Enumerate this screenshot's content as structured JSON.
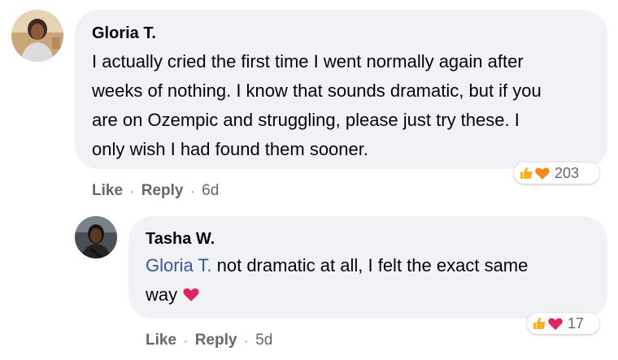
{
  "comments": [
    {
      "author": "Gloria T.",
      "text_lines": [
        "I actually cried the first time I went normally again after",
        "weeks of nothing. I know that sounds dramatic, but if you",
        "are on Ozempic and struggling, please just try these. I",
        "only wish I had found them sooner."
      ],
      "reactions": {
        "icons": [
          "thumbs-up-icon",
          "orange-heart-icon"
        ],
        "count": "203"
      },
      "actions": {
        "like": "Like",
        "reply": "Reply",
        "time": "6d"
      }
    },
    {
      "author": "Tasha W.",
      "mention": "Gloria T.",
      "text_line1_rest": " not dramatic at all, I felt the exact same",
      "text_line2": "way",
      "reactions": {
        "icons": [
          "thumbs-up-icon",
          "red-heart-icon"
        ],
        "count": "17"
      },
      "actions": {
        "like": "Like",
        "reply": "Reply",
        "time": "5d"
      }
    }
  ],
  "colors": {
    "bubble": "#f0f2f5",
    "mention": "#385898",
    "secondary_text": "#65676b",
    "like_yellow": "#f7b125",
    "orange_heart": "#f7871e",
    "red_heart": "#e0245e"
  }
}
